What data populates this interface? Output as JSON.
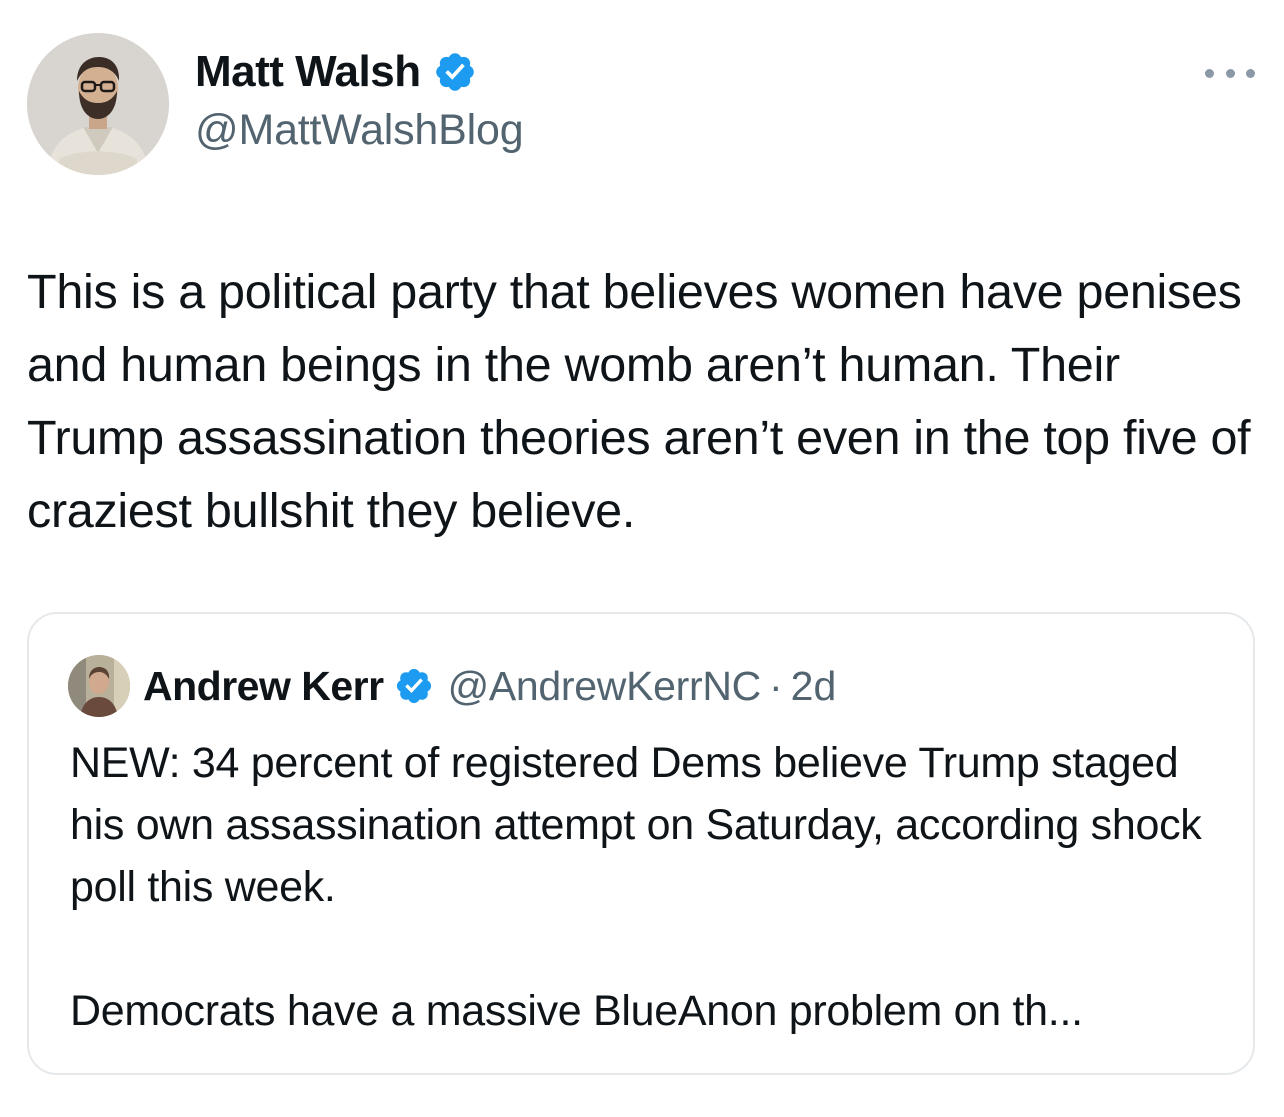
{
  "author": {
    "name": "Matt Walsh",
    "handle": "@MattWalshBlog",
    "verified": true
  },
  "tweet": {
    "text": "This is a political party that believes women have penises and human beings in the womb aren’t human. Their Trump assassination theories aren’t even in the top five of craziest bullshit they believe."
  },
  "quoted_tweet": {
    "author_name": "Andrew Kerr",
    "verified": true,
    "handle": "@AndrewKerrNC",
    "separator": "·",
    "time": "2d",
    "paragraph_1": "NEW: 34 percent of registered Dems believe Trump staged his own assassination attempt on Saturday, according shock poll this week.",
    "paragraph_2": "Democrats have a massive BlueAnon problem on th..."
  },
  "icons": {
    "verified": "verified-badge-icon",
    "more": "more-options-icon"
  },
  "colors": {
    "text_primary": "#0f1419",
    "text_secondary": "#536471",
    "verified_blue": "#1d9bf0",
    "border": "#e6e9ec"
  }
}
